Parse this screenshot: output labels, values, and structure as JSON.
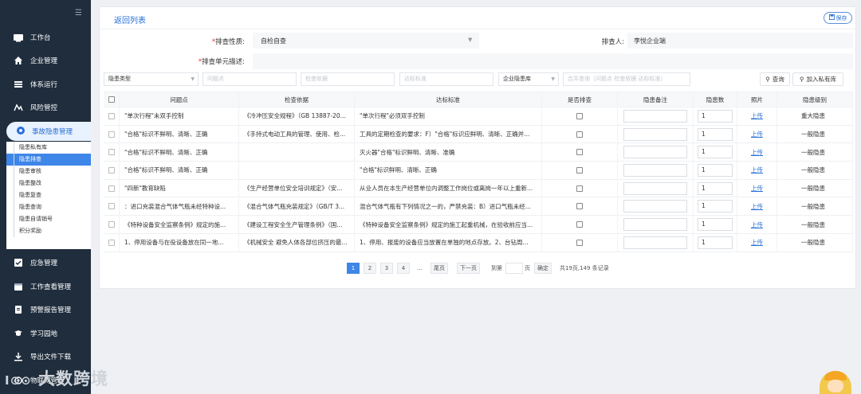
{
  "sidebar": {
    "items": [
      {
        "label": "工作台",
        "icon": "dashboard-icon"
      },
      {
        "label": "企业管理",
        "icon": "home-icon"
      },
      {
        "label": "体系运行",
        "icon": "layers-icon"
      },
      {
        "label": "风险管控",
        "icon": "risk-icon"
      },
      {
        "label": "事故隐患管理",
        "icon": "hazard-icon"
      },
      {
        "label": "应急管理",
        "icon": "emergency-icon"
      },
      {
        "label": "工作查看管理",
        "icon": "calendar-icon"
      },
      {
        "label": "预警报告管理",
        "icon": "report-icon"
      },
      {
        "label": "学习园地",
        "icon": "study-icon"
      },
      {
        "label": "导出文件下载",
        "icon": "download-icon"
      },
      {
        "label": "物联网管理",
        "icon": "iot-icon"
      }
    ],
    "submenu": [
      "隐患私有库",
      "隐患排查",
      "隐患审核",
      "隐患整改",
      "隐患复查",
      "隐患查询",
      "隐患自请销号",
      "积分奖励"
    ]
  },
  "header": {
    "back": "返回列表",
    "save": "保存"
  },
  "form": {
    "check_type_label": "排查性质:",
    "check_type_value": "自检自查",
    "checker_label": "排查人:",
    "checker_value": "李悦企业端",
    "unit_desc_label": "排查单元描述:"
  },
  "filters": {
    "hazard_type": "隐患类型",
    "problem": "问题点",
    "basis": "检查依据",
    "standard": "达标标准",
    "library": "企业隐患库",
    "keyword": "合并查询（问题点 检查依据 达标标准）",
    "query": "查询",
    "add_private": "加入私有库"
  },
  "table": {
    "headers": [
      "问题点",
      "检查依据",
      "达标标准",
      "是否排查",
      "隐患备注",
      "隐患数",
      "照片",
      "隐患级别"
    ],
    "upload_label": "上传",
    "rows": [
      {
        "problem": "\"单次行程\"未双手控制",
        "basis": "《冷冲压安全规程》（GB 13887-20...",
        "standard": "\"单次行程\"必须双手控制",
        "count": "1",
        "level": "重大隐患"
      },
      {
        "problem": "\"合格\"标识不鲜明、清晰、正确",
        "basis": "《手持式电动工具的管理、使用、检...",
        "standard": "工具的定期检查的要求：F）\"合格\"标识应鲜明、清晰、正确并...",
        "count": "1",
        "level": "一般隐患"
      },
      {
        "problem": "\"合格\"标识不鲜明、清晰、正确",
        "basis": "",
        "standard": "灭火器\"合格\"标识鲜明、清晰、准确",
        "count": "1",
        "level": "一般隐患"
      },
      {
        "problem": "\"合格\"标识不鲜明、清晰、正确",
        "basis": "",
        "standard": "\"合格\"标识鲜明、清晰、正确",
        "count": "1",
        "level": "一般隐患"
      },
      {
        "problem": "\"四新\"教育缺陷",
        "basis": "《生产经营单位安全培训规定》（安...",
        "standard": "从业人员在本生产经营单位内调整工作岗位或离岗一年以上重新...",
        "count": "1",
        "level": "一般隐患"
      },
      {
        "problem": "：进口充装混合气体气瓶未经特种设...",
        "basis": "《混合气体气瓶充装规定》（GB/T 3...",
        "standard": "混合气体气瓶有下列情况之一的，严禁充装：B）进口气瓶未经...",
        "count": "1",
        "level": "一般隐患"
      },
      {
        "problem": "《特种设备安全监察条例》规定的施...",
        "basis": "《建设工程安全生产管理条例》（国...",
        "standard": "《特种设备安全监察条例》规定的施工起重机械，在验收前应当...",
        "count": "1",
        "level": "一般隐患"
      },
      {
        "problem": "1、停用设备与在役设备放在同一地...",
        "basis": "《机械安全 避免人体各部位挤压的最...",
        "standard": "1、停用、报废的设备应当放置在单独的地点存放。2、台钻周...",
        "count": "1",
        "level": "一般隐患"
      }
    ]
  },
  "pagination": {
    "pages": [
      "1",
      "2",
      "3",
      "4"
    ],
    "ellipsis": "...",
    "first": "尾页",
    "next": "下一页",
    "goto": "到第",
    "page_unit": "页",
    "confirm": "确定",
    "summary": "共19页,149 条记录"
  },
  "watermark": "大数跨境",
  "colors": {
    "accent": "#3e86e8",
    "sidebar": "#1f2d3d",
    "required": "#e5322d"
  }
}
